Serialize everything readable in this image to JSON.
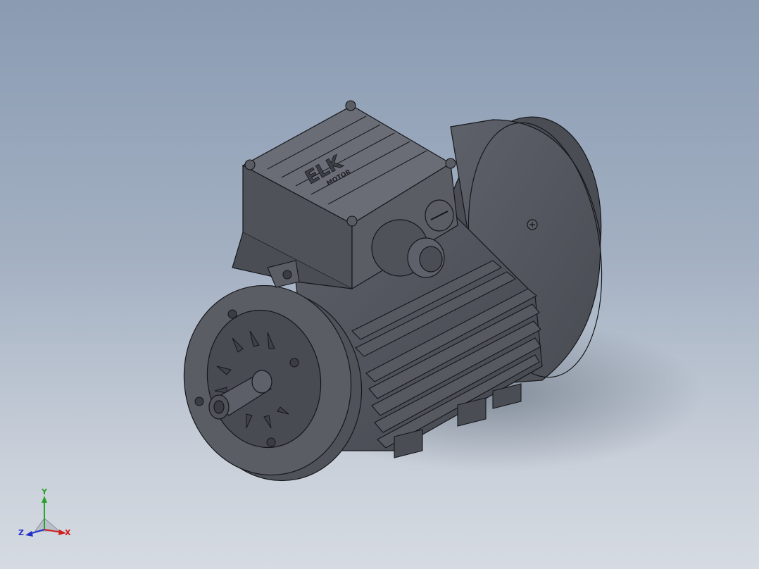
{
  "viewport": {
    "background_top": "#8a9bb2",
    "background_bottom": "#d6dbe2",
    "model_color": "#4f5259",
    "edge_color": "#15171b"
  },
  "model": {
    "logo_text": "ELK",
    "logo_subtext": "MOTOR"
  },
  "triad": {
    "x_label": "X",
    "y_label": "Y",
    "z_label": "Z",
    "x_color": "#d0201c",
    "y_color": "#2aa32a",
    "z_color": "#2131c8"
  }
}
